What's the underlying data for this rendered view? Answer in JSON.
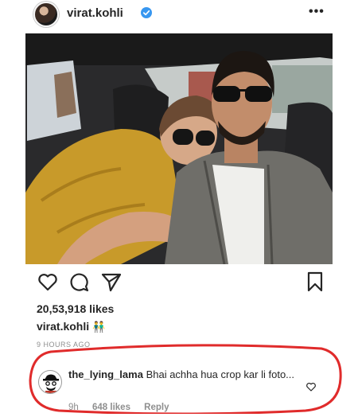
{
  "post": {
    "username": "virat.kohli",
    "more_label": "•••",
    "likes": "20,53,918 likes",
    "caption_user": "virat.kohli",
    "caption_emoji": "👬",
    "time_ago": "9 HOURS AGO"
  },
  "comment": {
    "username": "the_lying_lama",
    "text": "Bhai achha hua crop kar li foto...",
    "time": "9h",
    "likes": "648 likes",
    "reply_label": "Reply"
  },
  "colors": {
    "verified": "#3897f0",
    "annotation": "#e02b2b"
  },
  "icons": [
    "verified-icon",
    "heart-icon",
    "comment-icon",
    "share-icon",
    "bookmark-icon",
    "comment-heart-icon"
  ]
}
